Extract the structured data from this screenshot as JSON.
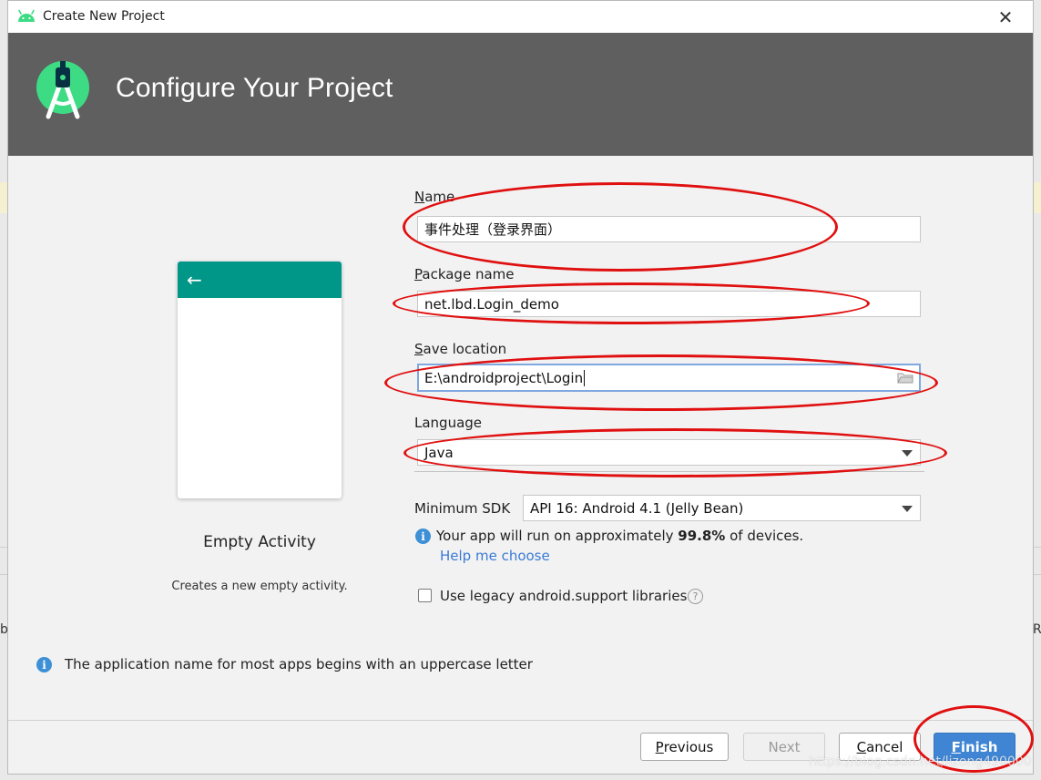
{
  "window": {
    "title": "Create New Project",
    "close_glyph": "✕"
  },
  "header": {
    "heading": "Configure Your Project"
  },
  "template": {
    "back_glyph": "←",
    "name": "Empty Activity",
    "description": "Creates a new empty activity."
  },
  "form": {
    "name": {
      "label_mnemonic": "N",
      "label_rest": "ame",
      "value": "事件处理（登录界面）"
    },
    "package_name": {
      "label_mnemonic": "P",
      "label_rest": "ackage name",
      "value": "net.lbd.Login_demo"
    },
    "save_location": {
      "label_mnemonic": "S",
      "label_rest": "ave location",
      "value": "E:\\androidproject\\Login"
    },
    "language": {
      "label": "Language",
      "selected": "Java"
    },
    "minimum_sdk": {
      "label": "Minimum SDK",
      "selected": "API 16: Android 4.1 (Jelly Bean)"
    },
    "coverage": {
      "prefix": "Your app will run on approximately ",
      "percent": "99.8%",
      "suffix": " of devices."
    },
    "help_link": "Help me choose",
    "legacy_checkbox": {
      "label": "Use legacy android.support libraries",
      "checked": false
    }
  },
  "validation_message": "The application name for most apps begins with an uppercase letter",
  "buttons": {
    "previous": {
      "mnemonic": "P",
      "rest": "revious"
    },
    "next": {
      "label": "Next"
    },
    "cancel": {
      "mnemonic": "C",
      "rest": "ancel"
    },
    "finish": {
      "mnemonic": "F",
      "rest": "inish"
    }
  },
  "watermark": "https://blog.csdn.net/lizong490000",
  "background": {
    "left_fragment": "b",
    "right_fragment": "R"
  },
  "colors": {
    "header_bg": "#5f5f5f",
    "appbar": "#009688",
    "link": "#3a7bd5",
    "primary_button": "#3f85d4",
    "annotation": "#e01010"
  }
}
